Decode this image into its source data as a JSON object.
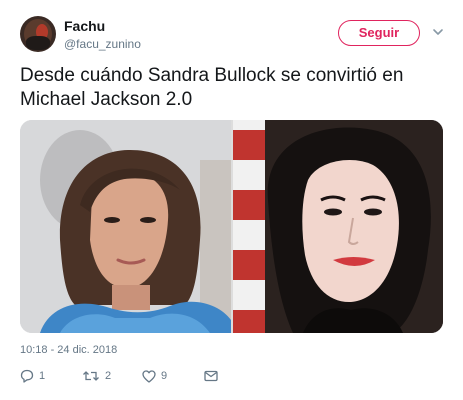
{
  "user": {
    "name": "Fachu",
    "handle": "@facu_zunino"
  },
  "follow_label": "Seguir",
  "tweet": {
    "text_line1": "Desde cuándo Sandra Bullock se convirtió en",
    "text_line2": "Michael Jackson 2.0",
    "timestamp": "10:18 - 24 dic. 2018"
  },
  "actions": {
    "replies": "1",
    "retweets": "2",
    "likes": "9"
  },
  "icons": [
    "avatar",
    "chevron-down-icon",
    "reply-icon",
    "retweet-icon",
    "like-icon",
    "message-icon"
  ],
  "colors": {
    "accent": "#e0245e",
    "muted": "#657786",
    "text": "#14171a"
  }
}
